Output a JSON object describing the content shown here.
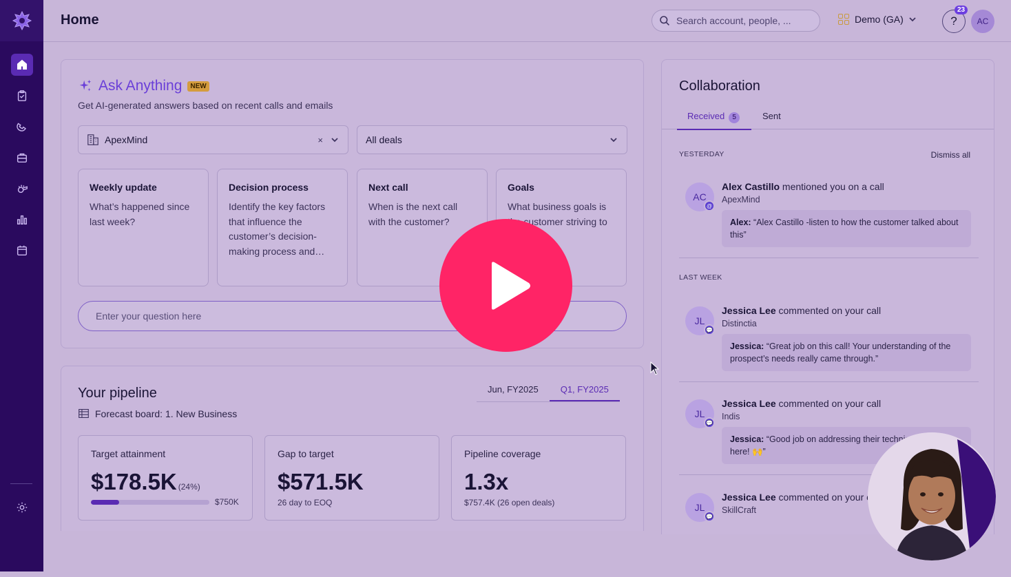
{
  "header": {
    "title": "Home",
    "search_placeholder": "Search account, people, ...",
    "workspace": "Demo (GA)",
    "help_label": "?",
    "notification_count": "23",
    "user_initials": "AC"
  },
  "sidebar": {
    "items": [
      "home",
      "tasks",
      "calls",
      "deals",
      "coaching",
      "insights",
      "calendar"
    ],
    "active": "home"
  },
  "ask": {
    "title": "Ask Anything",
    "badge": "NEW",
    "subtitle": "Get AI-generated answers based on recent calls and emails",
    "account_value": "ApexMind",
    "deals_value": "All deals",
    "clear": "×",
    "prompts": [
      {
        "title": "Weekly update",
        "text": "What’s happened since last week?"
      },
      {
        "title": "Decision process",
        "text": "Identify the key factors that influence the customer’s decision-making process and…"
      },
      {
        "title": "Next call",
        "text": "When is the next call with the customer?"
      },
      {
        "title": "Goals",
        "text": "What business goals is the customer striving to achieve?"
      }
    ],
    "question_placeholder": "Enter your question here"
  },
  "pipeline": {
    "title": "Your pipeline",
    "board": "Forecast board: 1. New Business",
    "tabs": [
      "Jun, FY2025",
      "Q1, FY2025"
    ],
    "active_tab": "Q1, FY2025",
    "metrics": [
      {
        "label": "Target attainment",
        "value": "$178.5K",
        "pct": "(24%)",
        "target": "$750K",
        "progress": 0.24
      },
      {
        "label": "Gap to target",
        "value": "$571.5K",
        "sub": "26 day to EOQ"
      },
      {
        "label": "Pipeline coverage",
        "value": "1.3x",
        "sub": "$757.4K (26 open deals)"
      }
    ]
  },
  "collaboration": {
    "title": "Collaboration",
    "tab_received": "Received",
    "received_count": "5",
    "tab_sent": "Sent",
    "section_yesterday": "YESTERDAY",
    "dismiss_all": "Dismiss all",
    "section_last_week": "LAST WEEK",
    "activities": [
      {
        "initials": "AC",
        "name": "Alex Castillo",
        "action": " mentioned you on a call",
        "account": "ApexMind",
        "quote_name": "Alex:",
        "quote": " “Alex Castillo -listen to how the customer talked about this”",
        "badge": "@"
      },
      {
        "initials": "JL",
        "name": "Jessica Lee",
        "action": " commented on your call",
        "account": "Distinctia",
        "quote_name": "Jessica:",
        "quote": " “Great job on this call! Your understanding of the prospect’s needs really came through.”",
        "badge": "💬"
      },
      {
        "initials": "JL",
        "name": "Jessica Lee",
        "action": " commented on your call",
        "account": "Indis",
        "quote_name": "Jessica:",
        "quote": " “Good job on addressing their technical questions here! 🙌”",
        "badge": "💬"
      },
      {
        "initials": "JL",
        "name": "Jessica Lee",
        "action": " commented on your call",
        "account": "SkillCraft",
        "badge": "💬"
      }
    ]
  },
  "colors": {
    "accent": "#6a3fd8",
    "sidebar": "#2a0a5e",
    "play": "#ff2466"
  }
}
